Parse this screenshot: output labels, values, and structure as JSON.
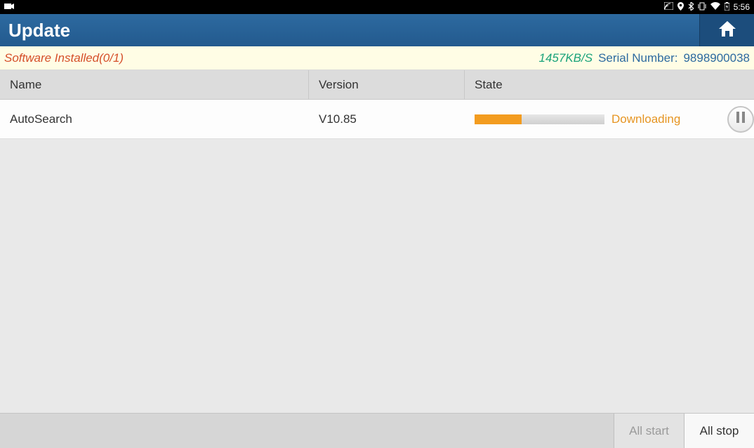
{
  "status": {
    "time": "5:56"
  },
  "header": {
    "title": "Update"
  },
  "info": {
    "installed": "Software Installed(0/1)",
    "speed": "1457KB/S",
    "serial_label": "Serial Number:",
    "serial_value": "9898900038"
  },
  "columns": {
    "name": "Name",
    "version": "Version",
    "state": "State"
  },
  "rows": [
    {
      "name": "AutoSearch",
      "version": "V10.85",
      "state_text": "Downloading",
      "progress_pct": 36
    }
  ],
  "footer": {
    "all_start": "All start",
    "all_stop": "All stop"
  }
}
